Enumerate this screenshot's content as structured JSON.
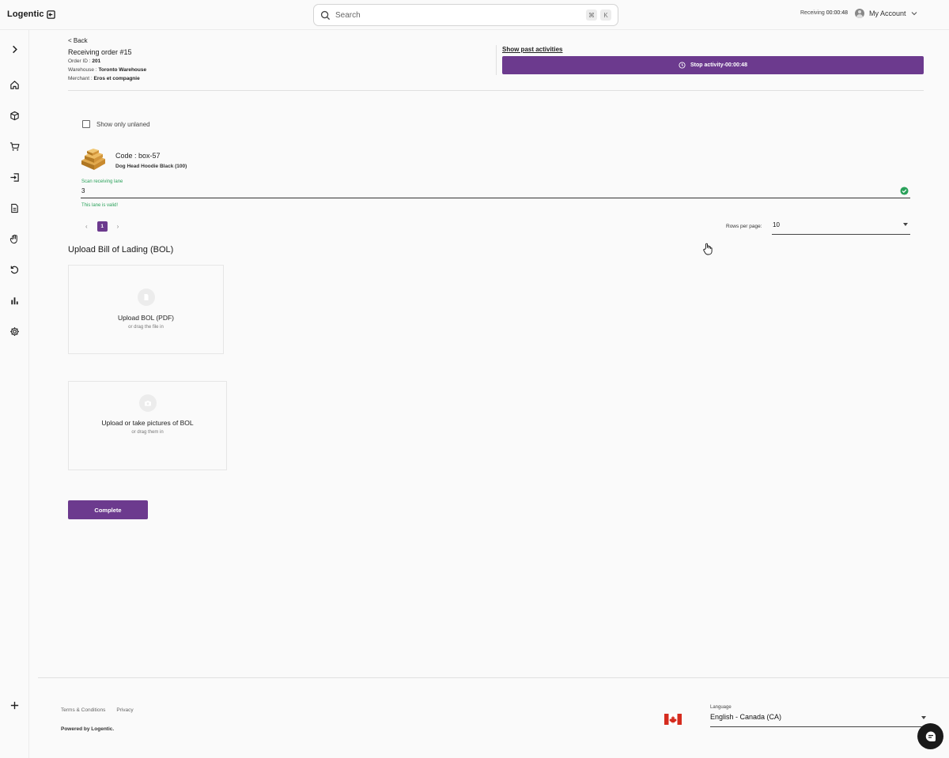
{
  "app": {
    "logo": "Logentic"
  },
  "search": {
    "placeholder": "Search",
    "shortcut_cmd": "⌘",
    "shortcut_key": "K"
  },
  "topbar": {
    "activity_label": "Receiving",
    "activity_timer": "00:00:48",
    "account_label": "My Account"
  },
  "sidebar": {
    "items": [
      {
        "name": "expand",
        "icon": "chevron-right-icon"
      },
      {
        "name": "home",
        "icon": "home-icon"
      },
      {
        "name": "products",
        "icon": "box-icon"
      },
      {
        "name": "orders",
        "icon": "cart-icon"
      },
      {
        "name": "receiving",
        "icon": "sign-in-icon"
      },
      {
        "name": "documents",
        "icon": "document-icon"
      },
      {
        "name": "picking",
        "icon": "hand-icon"
      },
      {
        "name": "returns",
        "icon": "undo-icon"
      },
      {
        "name": "reports",
        "icon": "bar-chart-icon"
      },
      {
        "name": "settings",
        "icon": "gear-icon"
      },
      {
        "name": "add",
        "icon": "plus-icon"
      }
    ]
  },
  "header": {
    "back_label": "< Back",
    "title": "Receiving order #15",
    "order_id_label": "Order ID :",
    "order_id": "201",
    "warehouse_label": "Warehouse :",
    "warehouse": "Toronto Warehouse",
    "merchant_label": "Merchant :",
    "merchant": "Eros et compagnie",
    "past_activities_label": "Show past activities",
    "stop_activity_label": "Stop activity-00:00:48"
  },
  "filters": {
    "show_unlaned_label": "Show only unlaned",
    "show_unlaned_checked": false
  },
  "item": {
    "code": "Code : box-57",
    "product_name": "Dog Head Hoodie Black (100)",
    "lane_label": "Scan receiving lane",
    "lane_value": "3",
    "lane_message": "This lane is valid!",
    "status_color": "#2aa15a"
  },
  "pagination": {
    "prev": "‹",
    "current_page": "1",
    "next": "›",
    "rows_per_page_label": "Rows per page:",
    "rows_per_page_value": "10"
  },
  "bol": {
    "title": "Upload Bill of Lading (BOL)",
    "pdf_main": "Upload BOL (PDF)",
    "pdf_sub": "or drag the file in",
    "pics_main": "Upload or take pictures of BOL",
    "pics_sub": "or drag them in"
  },
  "actions": {
    "complete_label": "Complete"
  },
  "footer": {
    "terms": "Terms & Conditions",
    "privacy": "Privacy",
    "powered": "Powered by Logentic.",
    "language_label": "Language",
    "language_value": "English - Canada (CA)"
  },
  "theme": {
    "accent": "#6c3a8e",
    "success": "#2aa15a"
  }
}
